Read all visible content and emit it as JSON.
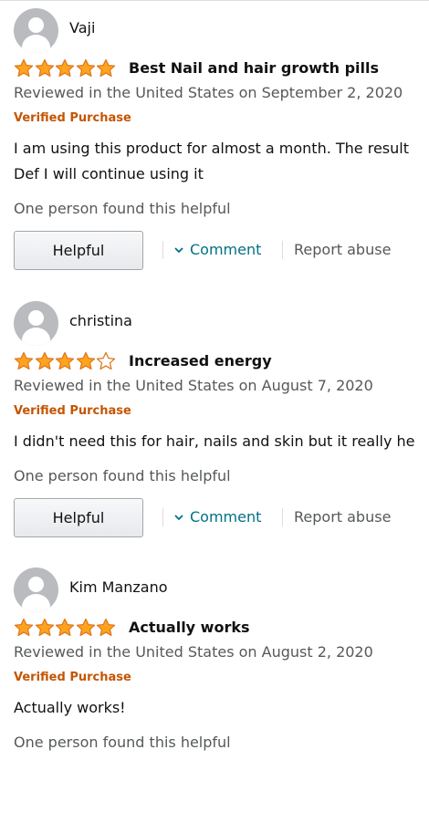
{
  "reviews": [
    {
      "name": "Vaji",
      "rating": 5,
      "title": "Best Nail and hair growth pills",
      "date": "Reviewed in the United States on September 2, 2020",
      "verified": "Verified Purchase",
      "body": [
        "I am using this product for almost a month. The result",
        "Def I will continue using it"
      ],
      "helpful_text": "One person found this helpful",
      "helpful_label": "Helpful",
      "comment_label": "Comment",
      "report_label": "Report abuse"
    },
    {
      "name": "christina",
      "rating": 4,
      "title": "Increased energy",
      "date": "Reviewed in the United States on August 7, 2020",
      "verified": "Verified Purchase",
      "body": [
        "I didn't need this for hair, nails and skin but it really he"
      ],
      "helpful_text": "One person found this helpful",
      "helpful_label": "Helpful",
      "comment_label": "Comment",
      "report_label": "Report abuse"
    },
    {
      "name": "Kim Manzano",
      "rating": 5,
      "title": "Actually works",
      "date": "Reviewed in the United States on August 2, 2020",
      "verified": "Verified Purchase",
      "body": [
        "Actually works!"
      ],
      "helpful_text": "One person found this helpful"
    }
  ],
  "colors": {
    "star_fill": "#ffa41c",
    "star_stroke": "#de7921",
    "verified": "#c45500",
    "link": "#007185",
    "muted": "#565959"
  },
  "icons": {
    "avatar": "user-avatar-icon",
    "star": "star-icon",
    "chevron": "chevron-down-icon"
  }
}
